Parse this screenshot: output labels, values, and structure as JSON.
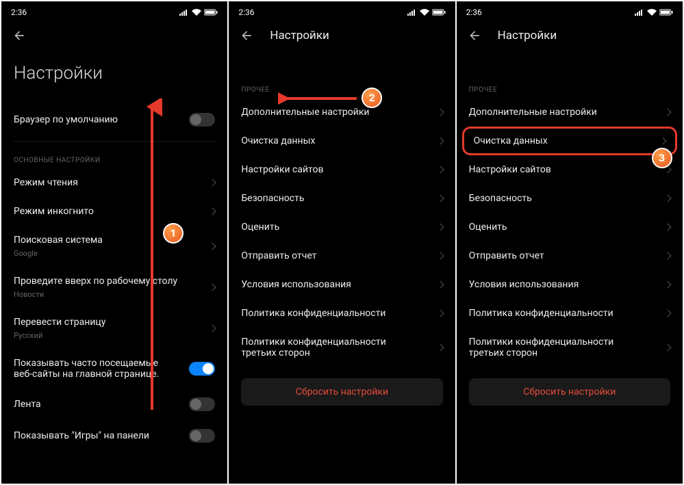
{
  "status_time": "2:36",
  "screens": {
    "first": {
      "big_title": "Настройки",
      "default_browser": "Браузер по умолчанию",
      "section1": "ОСНОВНЫЕ НАСТРОЙКИ",
      "items": {
        "reading_mode": "Режим чтения",
        "incognito": "Режим инкогнито",
        "search_engine": "Поисковая система",
        "search_engine_sub": "Google",
        "swipe_up": "Проведите вверх по рабочему столу",
        "swipe_up_sub": "Новости",
        "translate": "Перевести страницу",
        "translate_sub": "Русский",
        "show_frequent": "Показывать часто посещаемые веб-сайты на главной странице.",
        "feed": "Лента",
        "show_games": "Показывать \"Игры\" на панели"
      }
    },
    "second": {
      "title": "Настройки",
      "section": "ПРОЧЕЕ",
      "items": {
        "additional": "Дополнительные настройки",
        "clear_data": "Очистка данных",
        "site_settings": "Настройки сайтов",
        "security": "Безопасность",
        "rate": "Оценить",
        "send_report": "Отправить отчет",
        "terms": "Условия использования",
        "privacy": "Политика конфиденциальности",
        "third_party": "Политики конфиденциальности третьих сторон"
      },
      "reset": "Сбросить настройки"
    },
    "third": {
      "title": "Настройки",
      "section": "ПРОЧЕЕ",
      "items": {
        "additional": "Дополнительные настройки",
        "clear_data": "Очистка данных",
        "site_settings": "Настройки сайтов",
        "security": "Безопасность",
        "rate": "Оценить",
        "send_report": "Отправить отчет",
        "terms": "Условия использования",
        "privacy": "Политика конфиденциальности",
        "third_party": "Политики конфиденциальности третьих сторон"
      },
      "reset": "Сбросить настройки"
    }
  },
  "badges": {
    "1": "1",
    "2": "2",
    "3": "3"
  },
  "colors": {
    "accent_red": "#e53a2b",
    "badge_orange": "#e85a1f",
    "toggle_on": "#0a84ff",
    "reset_text": "#e64b3a"
  }
}
